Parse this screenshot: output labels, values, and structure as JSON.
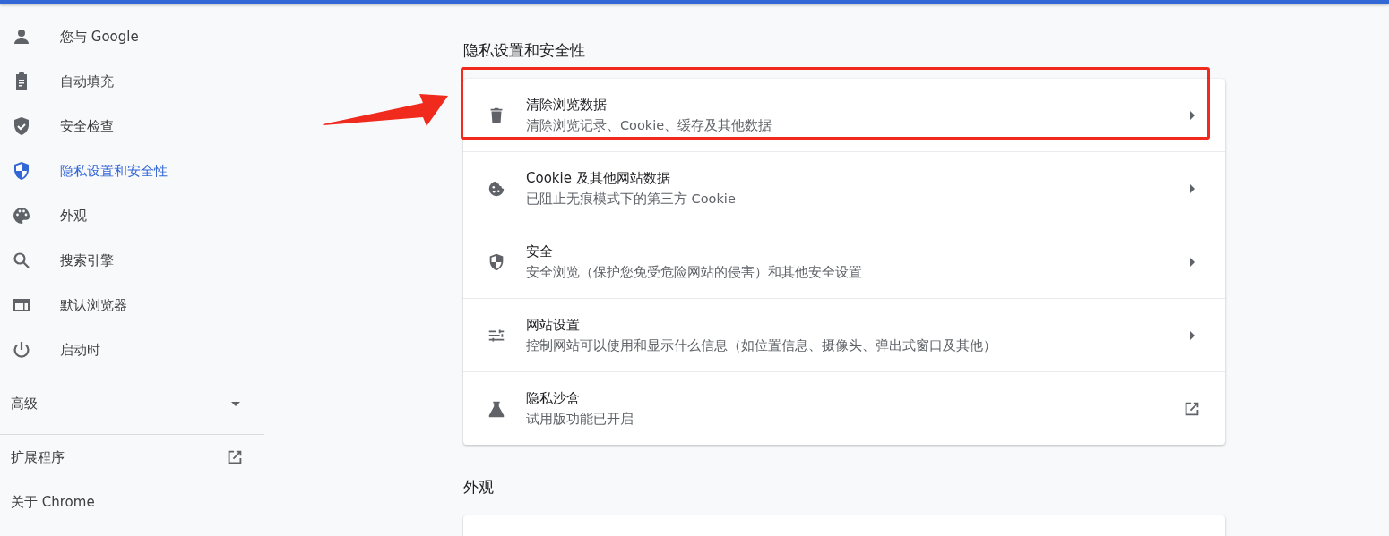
{
  "sidebar": {
    "items": [
      {
        "label": "您与 Google",
        "selected": false
      },
      {
        "label": "自动填充",
        "selected": false
      },
      {
        "label": "安全检查",
        "selected": false
      },
      {
        "label": "隐私设置和安全性",
        "selected": true
      },
      {
        "label": "外观",
        "selected": false
      },
      {
        "label": "搜索引擎",
        "selected": false
      },
      {
        "label": "默认浏览器",
        "selected": false
      },
      {
        "label": "启动时",
        "selected": false
      }
    ],
    "advanced": {
      "label": "高级",
      "expanded": false
    },
    "links": [
      {
        "label": "扩展程序",
        "kind": "external"
      },
      {
        "label": "关于 Chrome",
        "kind": "plain"
      }
    ]
  },
  "sections": [
    {
      "title": "隐私设置和安全性",
      "rows": [
        {
          "title": "清除浏览数据",
          "subtitle": "清除浏览记录、Cookie、缓存及其他数据",
          "kind": "submenu",
          "highlighted": true
        },
        {
          "title": "Cookie 及其他网站数据",
          "subtitle": "已阻止无痕模式下的第三方 Cookie",
          "kind": "submenu",
          "highlighted": false
        },
        {
          "title": "安全",
          "subtitle": "安全浏览（保护您免受危险网站的侵害）和其他安全设置",
          "kind": "submenu",
          "highlighted": false
        },
        {
          "title": "网站设置",
          "subtitle": "控制网站可以使用和显示什么信息（如位置信息、摄像头、弹出式窗口及其他）",
          "kind": "submenu",
          "highlighted": false
        },
        {
          "title": "隐私沙盒",
          "subtitle": "试用版功能已开启",
          "kind": "external",
          "highlighted": false
        }
      ]
    },
    {
      "title": "外观"
    }
  ]
}
